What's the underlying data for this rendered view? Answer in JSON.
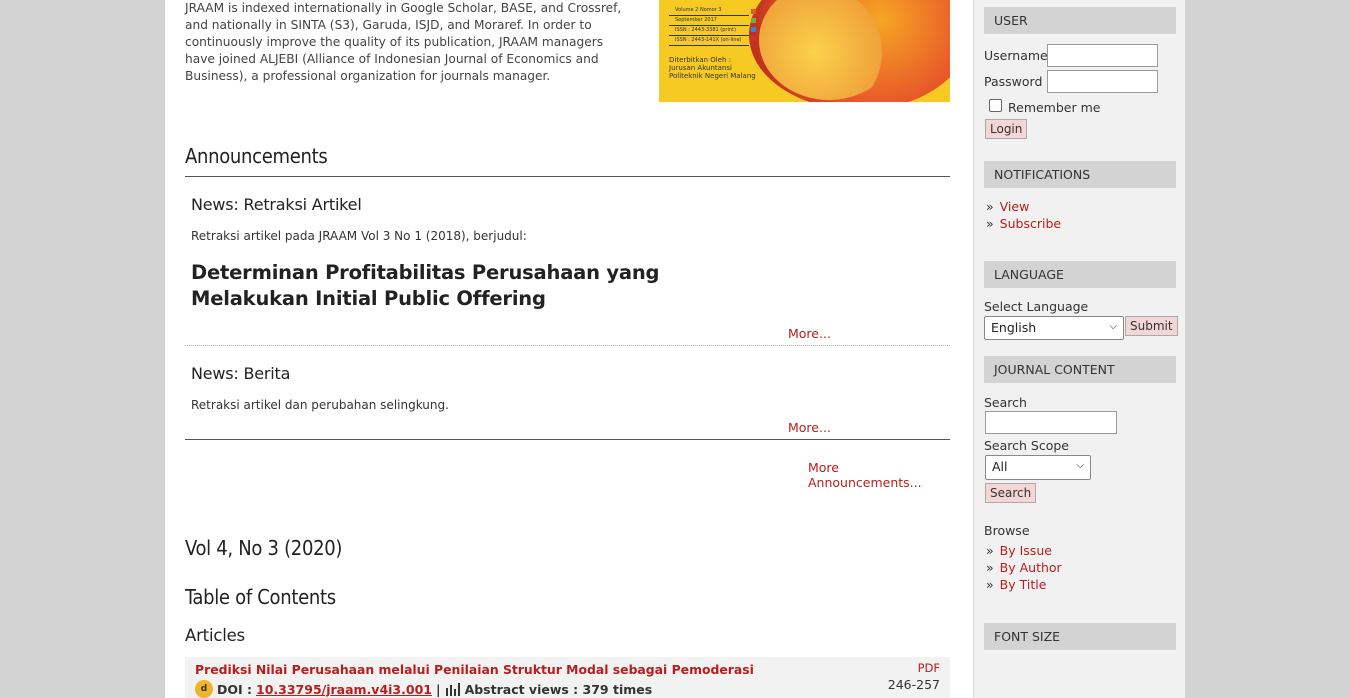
{
  "intro": {
    "text": "JRAAM is indexed internationally in Google Scholar, BASE, and Crossref, and nationally in SINTA (S3), Garuda, ISJD, and Moraref. In order to continuously improve the quality of its publication, JRAAM managers have joined ALJEBI (Alliance of Indonesian Journal of Economics and Business), a professional organization for journals manager."
  },
  "cover": {
    "lines": [
      "Volume 2 Nomor 3",
      "September 2017",
      "ISSN : 2443-3381 (print)",
      "ISSN : 2443-141X (on-line)"
    ],
    "publisher": [
      "Diterbitkan Oleh :",
      "Jurusan Akuntansi",
      "Politeknik Negeri Malang"
    ],
    "colors": {
      "bg": "#f6c923",
      "orange": "#e8552a"
    }
  },
  "announcements": {
    "heading": "Announcements",
    "items": [
      {
        "title": "News: Retraksi Artikel",
        "text": "Retraksi artikel pada JRAAM Vol 3 No 1 (2018), berjudul:",
        "highlight": "Determinan Profitabilitas Perusahaan yang Melakukan Initial Public Offering",
        "more": "More..."
      },
      {
        "title": "News: Berita",
        "text": "Retraksi artikel dan perubahan selingkung.",
        "more": "More..."
      }
    ],
    "more_all": "More Announcements..."
  },
  "issue": {
    "heading": "Vol 4, No 3 (2020)",
    "toc_heading": "Table of Contents",
    "section": "Articles",
    "articles": [
      {
        "title": "Prediksi Nilai Perusahaan melalui Penilaian Struktur Modal sebagai Pemoderasi",
        "pdf": "PDF",
        "pages": "246-257",
        "doi_label": "DOI :",
        "doi": "10.33795/jraam.v4i3.001",
        "separator": "|",
        "views": "Abstract views : 379 times"
      }
    ]
  },
  "sidebar": {
    "user": {
      "heading": "USER",
      "username_label": "Username",
      "password_label": "Password",
      "remember_label": "Remember me",
      "login_button": "Login"
    },
    "notifications": {
      "heading": "NOTIFICATIONS",
      "links": [
        "View",
        "Subscribe"
      ]
    },
    "language": {
      "heading": "LANGUAGE",
      "label": "Select Language",
      "selected": "English",
      "submit": "Submit"
    },
    "journal_content": {
      "heading": "JOURNAL CONTENT",
      "search_label": "Search",
      "scope_label": "Search Scope",
      "scope_selected": "All",
      "search_button": "Search",
      "browse_label": "Browse",
      "browse_links": [
        "By Issue",
        "By Author",
        "By Title"
      ]
    },
    "font_size": {
      "heading": "FONT SIZE"
    }
  },
  "colors": {
    "link": "#b5201d",
    "sidebar_bg": "#f1f1f1",
    "header_bg": "#d3d3d3"
  }
}
